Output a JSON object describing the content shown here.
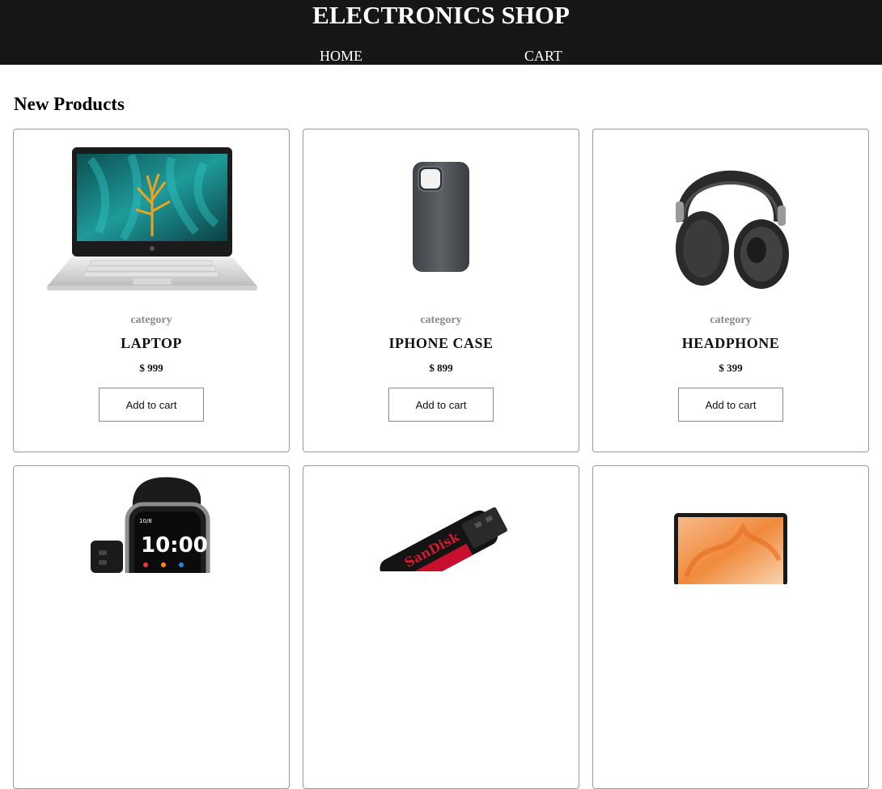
{
  "header": {
    "title": "ELECTRONICS SHOP",
    "nav": {
      "home": "HOME",
      "cart": "CART"
    }
  },
  "main": {
    "heading": "New Products",
    "products": [
      {
        "category": "category",
        "name": "LAPTOP",
        "price": "$ 999",
        "button": "Add to cart",
        "image": "laptop-image"
      },
      {
        "category": "category",
        "name": "IPHONE CASE",
        "price": "$ 899",
        "button": "Add to cart",
        "image": "phone-case-image"
      },
      {
        "category": "category",
        "name": "HEADPHONE",
        "price": "$ 399",
        "button": "Add to cart",
        "image": "headphone-image"
      },
      {
        "image": "smartwatch-image"
      },
      {
        "image": "usb-drive-image"
      },
      {
        "image": "macbook-image"
      }
    ]
  },
  "colors": {
    "header_bg": "#161616",
    "header_text": "#ffffff",
    "card_border": "#9a9a9a",
    "category_text": "#8a8a8a"
  }
}
